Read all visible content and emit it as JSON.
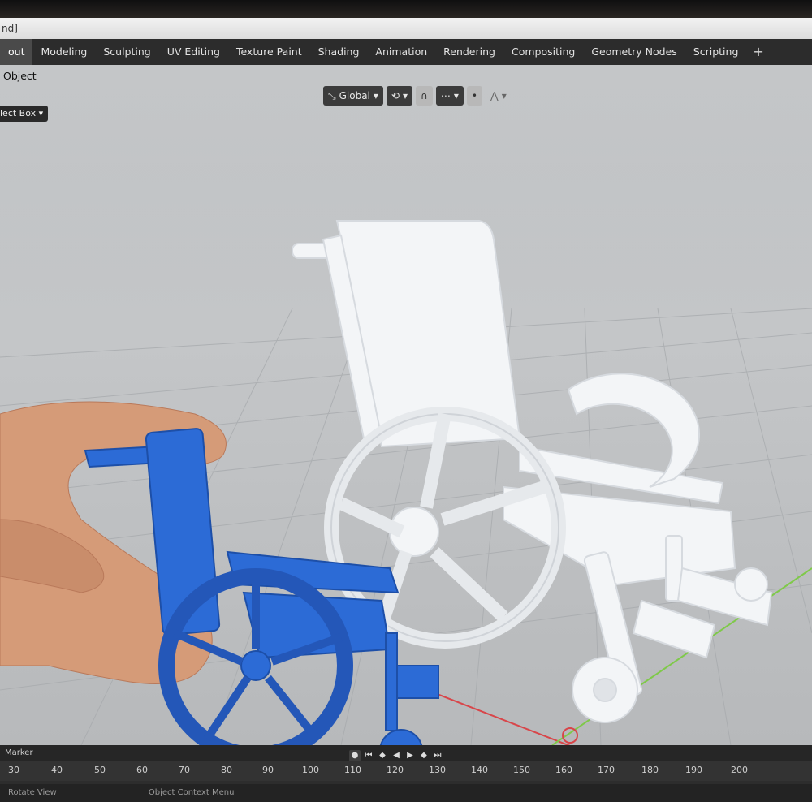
{
  "window": {
    "title_fragment": "nd]"
  },
  "workspaces": {
    "tabs": [
      "out",
      "Modeling",
      "Sculpting",
      "UV Editing",
      "Texture Paint",
      "Shading",
      "Animation",
      "Rendering",
      "Compositing",
      "Geometry Nodes",
      "Scripting"
    ],
    "active_index": 0,
    "add_label": "+"
  },
  "header": {
    "object_menu": "Object",
    "select_box": "lect Box",
    "transform_orientation": "Global"
  },
  "timeline": {
    "marker_label": "Marker",
    "ticks": [
      "30",
      "40",
      "50",
      "60",
      "70",
      "80",
      "90",
      "100",
      "110",
      "120",
      "130",
      "140",
      "150",
      "160",
      "170",
      "180",
      "190",
      "200"
    ]
  },
  "status_bar": {
    "items": [
      "Rotate View",
      "Object Context Menu"
    ]
  },
  "colors": {
    "viewport_bg": "#bfc2c4",
    "model_white": "#f3f5f7",
    "printed_blue": "#2c6bd6",
    "x_axis": "#d8464a",
    "y_axis": "#7fc94a"
  }
}
